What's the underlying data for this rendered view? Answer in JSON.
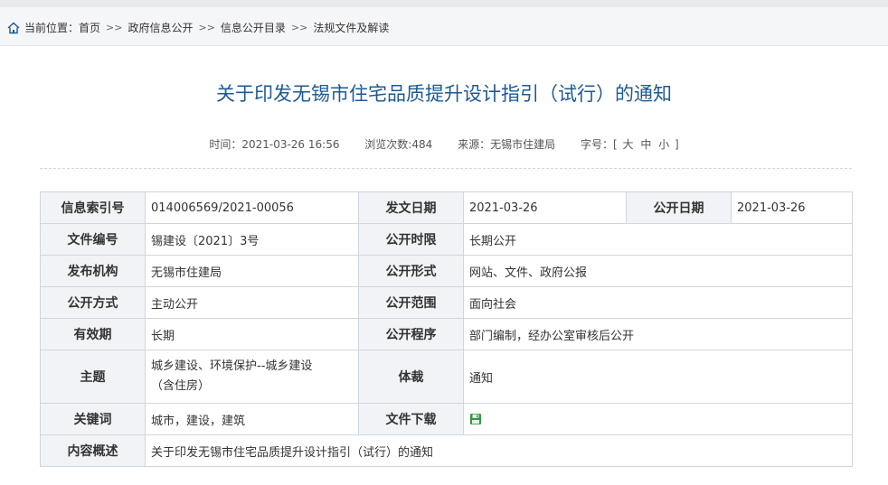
{
  "breadcrumb": {
    "prefix": "当前位置：",
    "items": [
      "首页",
      "政府信息公开",
      "信息公开目录",
      "法规文件及解读"
    ],
    "separator": ">>"
  },
  "article": {
    "title": "关于印发无锡市住宅品质提升设计指引（试行）的通知",
    "time_label": "时间：",
    "time_value": "2021-03-26 16:56",
    "views_label": "浏览次数:",
    "views_value": "484",
    "source_label": "来源：",
    "source_value": "无锡市住建局",
    "fontsize_label": "字号：",
    "fontsize_open": "[",
    "fontsize_large": "大",
    "fontsize_medium": "中",
    "fontsize_small": "小",
    "fontsize_close": "]"
  },
  "info_table": {
    "index_label": "信息索引号",
    "index_value": "014006569/2021-00056",
    "issue_date_label": "发文日期",
    "issue_date_value": "2021-03-26",
    "public_date_label": "公开日期",
    "public_date_value": "2021-03-26",
    "doc_no_label": "文件编号",
    "doc_no_value": "锡建设〔2021〕3号",
    "time_limit_label": "公开时限",
    "time_limit_value": "长期公开",
    "publisher_label": "发布机构",
    "publisher_value": "无锡市住建局",
    "form_label": "公开形式",
    "form_value": "网站、文件、政府公报",
    "method_label": "公开方式",
    "method_value": "主动公开",
    "scope_label": "公开范围",
    "scope_value": "面向社会",
    "validity_label": "有效期",
    "validity_value": "长期",
    "procedure_label": "公开程序",
    "procedure_value": "部门编制，经办公室审核后公开",
    "topic_label": "主题",
    "topic_value_line1": "城乡建设、环境保护--城乡建设",
    "topic_value_line2": "（含住房）",
    "genre_label": "体裁",
    "genre_value": "通知",
    "keywords_label": "关键词",
    "keywords_value": "城市，建设，建筑",
    "download_label": "文件下载",
    "download_icon": "save-disk-icon",
    "summary_label": "内容概述",
    "summary_value": "关于印发无锡市住宅品质提升设计指引（试行）的通知"
  },
  "colors": {
    "title": "#1c5a96",
    "label_bg": "#f1f3f6",
    "border": "#cfd6e0",
    "download_icon": "#2e9a3a"
  }
}
